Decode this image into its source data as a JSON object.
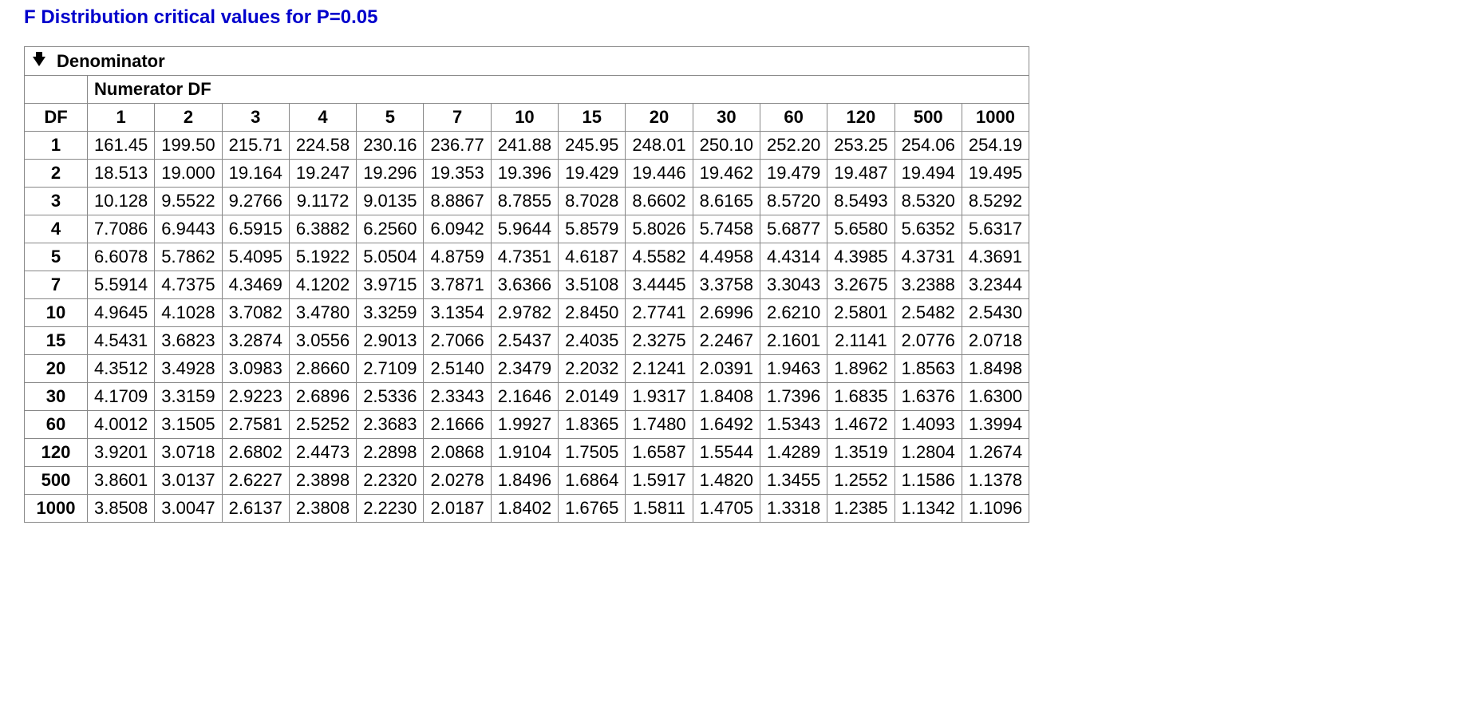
{
  "title": "F Distribution critical values for P=0.05",
  "denominator_label": "Denominator",
  "numerator_label": "Numerator DF",
  "df_label": "DF",
  "numerator_df": [
    "1",
    "2",
    "3",
    "4",
    "5",
    "7",
    "10",
    "15",
    "20",
    "30",
    "60",
    "120",
    "500",
    "1000"
  ],
  "denominator_df": [
    "1",
    "2",
    "3",
    "4",
    "5",
    "7",
    "10",
    "15",
    "20",
    "30",
    "60",
    "120",
    "500",
    "1000"
  ],
  "rows": [
    [
      "161.45",
      "199.50",
      "215.71",
      "224.58",
      "230.16",
      "236.77",
      "241.88",
      "245.95",
      "248.01",
      "250.10",
      "252.20",
      "253.25",
      "254.06",
      "254.19"
    ],
    [
      "18.513",
      "19.000",
      "19.164",
      "19.247",
      "19.296",
      "19.353",
      "19.396",
      "19.429",
      "19.446",
      "19.462",
      "19.479",
      "19.487",
      "19.494",
      "19.495"
    ],
    [
      "10.128",
      "9.5522",
      "9.2766",
      "9.1172",
      "9.0135",
      "8.8867",
      "8.7855",
      "8.7028",
      "8.6602",
      "8.6165",
      "8.5720",
      "8.5493",
      "8.5320",
      "8.5292"
    ],
    [
      "7.7086",
      "6.9443",
      "6.5915",
      "6.3882",
      "6.2560",
      "6.0942",
      "5.9644",
      "5.8579",
      "5.8026",
      "5.7458",
      "5.6877",
      "5.6580",
      "5.6352",
      "5.6317"
    ],
    [
      "6.6078",
      "5.7862",
      "5.4095",
      "5.1922",
      "5.0504",
      "4.8759",
      "4.7351",
      "4.6187",
      "4.5582",
      "4.4958",
      "4.4314",
      "4.3985",
      "4.3731",
      "4.3691"
    ],
    [
      "5.5914",
      "4.7375",
      "4.3469",
      "4.1202",
      "3.9715",
      "3.7871",
      "3.6366",
      "3.5108",
      "3.4445",
      "3.3758",
      "3.3043",
      "3.2675",
      "3.2388",
      "3.2344"
    ],
    [
      "4.9645",
      "4.1028",
      "3.7082",
      "3.4780",
      "3.3259",
      "3.1354",
      "2.9782",
      "2.8450",
      "2.7741",
      "2.6996",
      "2.6210",
      "2.5801",
      "2.5482",
      "2.5430"
    ],
    [
      "4.5431",
      "3.6823",
      "3.2874",
      "3.0556",
      "2.9013",
      "2.7066",
      "2.5437",
      "2.4035",
      "2.3275",
      "2.2467",
      "2.1601",
      "2.1141",
      "2.0776",
      "2.0718"
    ],
    [
      "4.3512",
      "3.4928",
      "3.0983",
      "2.8660",
      "2.7109",
      "2.5140",
      "2.3479",
      "2.2032",
      "2.1241",
      "2.0391",
      "1.9463",
      "1.8962",
      "1.8563",
      "1.8498"
    ],
    [
      "4.1709",
      "3.3159",
      "2.9223",
      "2.6896",
      "2.5336",
      "2.3343",
      "2.1646",
      "2.0149",
      "1.9317",
      "1.8408",
      "1.7396",
      "1.6835",
      "1.6376",
      "1.6300"
    ],
    [
      "4.0012",
      "3.1505",
      "2.7581",
      "2.5252",
      "2.3683",
      "2.1666",
      "1.9927",
      "1.8365",
      "1.7480",
      "1.6492",
      "1.5343",
      "1.4672",
      "1.4093",
      "1.3994"
    ],
    [
      "3.9201",
      "3.0718",
      "2.6802",
      "2.4473",
      "2.2898",
      "2.0868",
      "1.9104",
      "1.7505",
      "1.6587",
      "1.5544",
      "1.4289",
      "1.3519",
      "1.2804",
      "1.2674"
    ],
    [
      "3.8601",
      "3.0137",
      "2.6227",
      "2.3898",
      "2.2320",
      "2.0278",
      "1.8496",
      "1.6864",
      "1.5917",
      "1.4820",
      "1.3455",
      "1.2552",
      "1.1586",
      "1.1378"
    ],
    [
      "3.8508",
      "3.0047",
      "2.6137",
      "2.3808",
      "2.2230",
      "2.0187",
      "1.8402",
      "1.6765",
      "1.5811",
      "1.4705",
      "1.3318",
      "1.2385",
      "1.1342",
      "1.1096"
    ]
  ],
  "chart_data": {
    "type": "table",
    "title": "F Distribution critical values for P=0.05",
    "xlabel": "Numerator DF",
    "ylabel": "Denominator DF",
    "x": [
      1,
      2,
      3,
      4,
      5,
      7,
      10,
      15,
      20,
      30,
      60,
      120,
      500,
      1000
    ],
    "y": [
      1,
      2,
      3,
      4,
      5,
      7,
      10,
      15,
      20,
      30,
      60,
      120,
      500,
      1000
    ],
    "values": [
      [
        161.45,
        199.5,
        215.71,
        224.58,
        230.16,
        236.77,
        241.88,
        245.95,
        248.01,
        250.1,
        252.2,
        253.25,
        254.06,
        254.19
      ],
      [
        18.513,
        19.0,
        19.164,
        19.247,
        19.296,
        19.353,
        19.396,
        19.429,
        19.446,
        19.462,
        19.479,
        19.487,
        19.494,
        19.495
      ],
      [
        10.128,
        9.5522,
        9.2766,
        9.1172,
        9.0135,
        8.8867,
        8.7855,
        8.7028,
        8.6602,
        8.6165,
        8.572,
        8.5493,
        8.532,
        8.5292
      ],
      [
        7.7086,
        6.9443,
        6.5915,
        6.3882,
        6.256,
        6.0942,
        5.9644,
        5.8579,
        5.8026,
        5.7458,
        5.6877,
        5.658,
        5.6352,
        5.6317
      ],
      [
        6.6078,
        5.7862,
        5.4095,
        5.1922,
        5.0504,
        4.8759,
        4.7351,
        4.6187,
        4.5582,
        4.4958,
        4.4314,
        4.3985,
        4.3731,
        4.3691
      ],
      [
        5.5914,
        4.7375,
        4.3469,
        4.1202,
        3.9715,
        3.7871,
        3.6366,
        3.5108,
        3.4445,
        3.3758,
        3.3043,
        3.2675,
        3.2388,
        3.2344
      ],
      [
        4.9645,
        4.1028,
        3.7082,
        3.478,
        3.3259,
        3.1354,
        2.9782,
        2.845,
        2.7741,
        2.6996,
        2.621,
        2.5801,
        2.5482,
        2.543
      ],
      [
        4.5431,
        3.6823,
        3.2874,
        3.0556,
        2.9013,
        2.7066,
        2.5437,
        2.4035,
        2.3275,
        2.2467,
        2.1601,
        2.1141,
        2.0776,
        2.0718
      ],
      [
        4.3512,
        3.4928,
        3.0983,
        2.866,
        2.7109,
        2.514,
        2.3479,
        2.2032,
        2.1241,
        2.0391,
        1.9463,
        1.8962,
        1.8563,
        1.8498
      ],
      [
        4.1709,
        3.3159,
        2.9223,
        2.6896,
        2.5336,
        2.3343,
        2.1646,
        2.0149,
        1.9317,
        1.8408,
        1.7396,
        1.6835,
        1.6376,
        1.63
      ],
      [
        4.0012,
        3.1505,
        2.7581,
        2.5252,
        2.3683,
        2.1666,
        1.9927,
        1.8365,
        1.748,
        1.6492,
        1.5343,
        1.4672,
        1.4093,
        1.3994
      ],
      [
        3.9201,
        3.0718,
        2.6802,
        2.4473,
        2.2898,
        2.0868,
        1.9104,
        1.7505,
        1.6587,
        1.5544,
        1.4289,
        1.3519,
        1.2804,
        1.2674
      ],
      [
        3.8601,
        3.0137,
        2.6227,
        2.3898,
        2.232,
        2.0278,
        1.8496,
        1.6864,
        1.5917,
        1.482,
        1.3455,
        1.2552,
        1.1586,
        1.1378
      ],
      [
        3.8508,
        3.0047,
        2.6137,
        2.3808,
        2.223,
        2.0187,
        1.8402,
        1.6765,
        1.5811,
        1.4705,
        1.3318,
        1.2385,
        1.1342,
        1.1096
      ]
    ]
  }
}
